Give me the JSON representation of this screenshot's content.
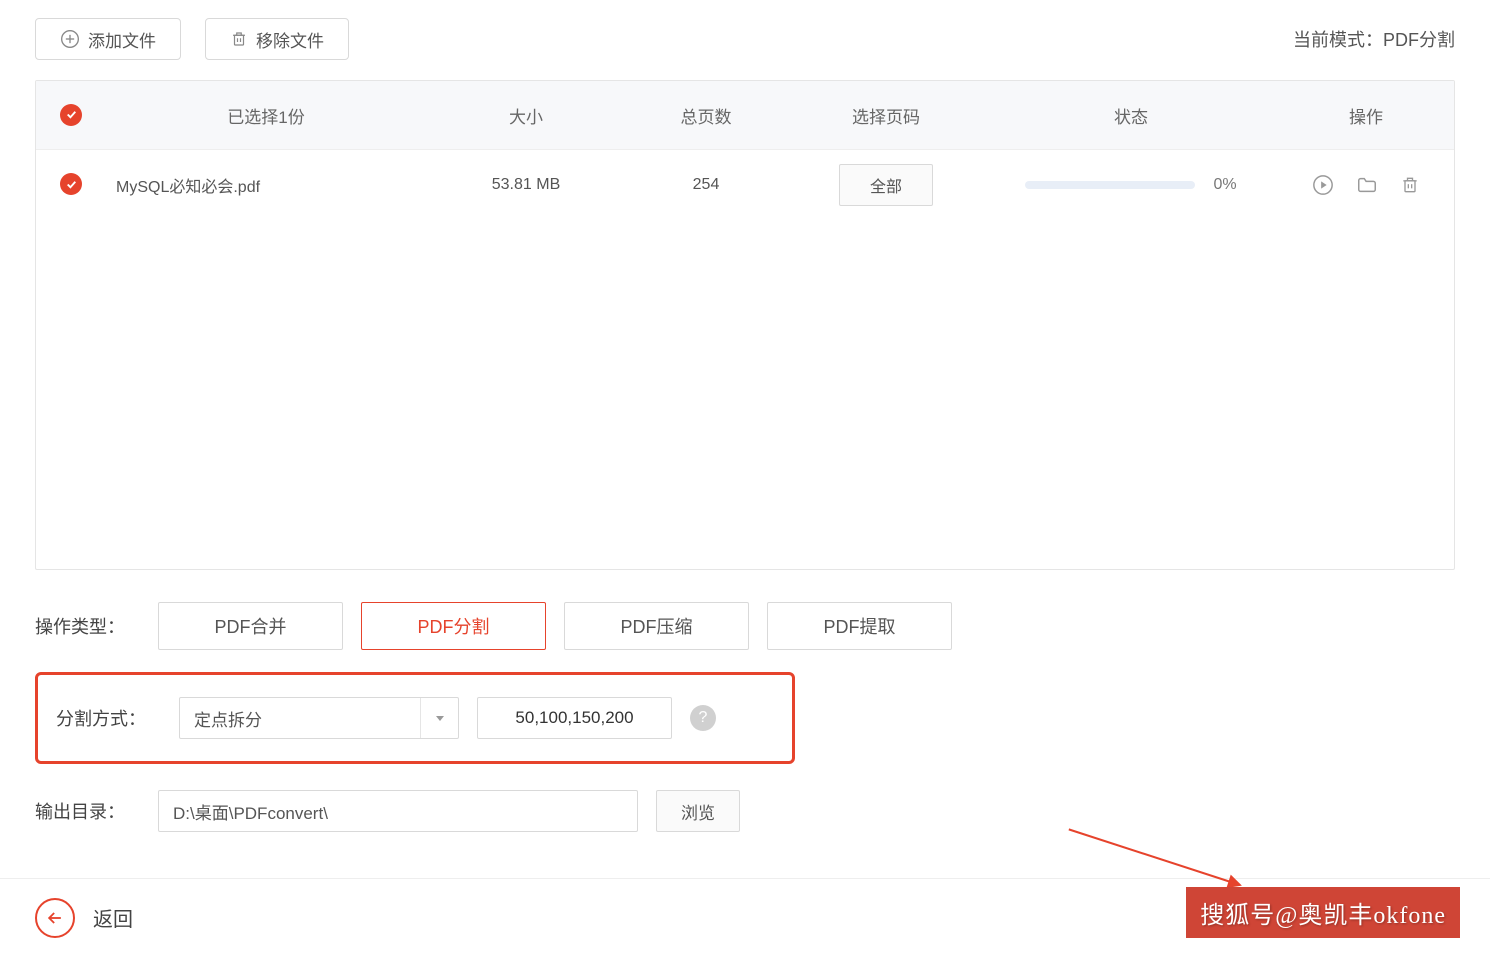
{
  "toolbar": {
    "add_file": "添加文件",
    "remove_file": "移除文件",
    "mode_label": "当前模式：PDF分割"
  },
  "table": {
    "headers": {
      "selected": "已选择1份",
      "size": "大小",
      "pages": "总页数",
      "page_select": "选择页码",
      "status": "状态",
      "actions": "操作"
    },
    "row": {
      "filename": "MySQL必知必会.pdf",
      "size": "53.81 MB",
      "pages": "254",
      "page_btn": "全部",
      "percent": "0%"
    }
  },
  "ops": {
    "label": "操作类型：",
    "merge": "PDF合并",
    "split": "PDF分割",
    "compress": "PDF压缩",
    "extract": "PDF提取"
  },
  "split": {
    "label": "分割方式：",
    "method": "定点拆分",
    "values": "50,100,150,200"
  },
  "output": {
    "label": "输出目录：",
    "path": "D:\\桌面\\PDFconvert\\",
    "browse": "浏览"
  },
  "footer": {
    "back": "返回"
  },
  "watermark": "搜狐号@奥凯丰okfone",
  "help_char": "?"
}
